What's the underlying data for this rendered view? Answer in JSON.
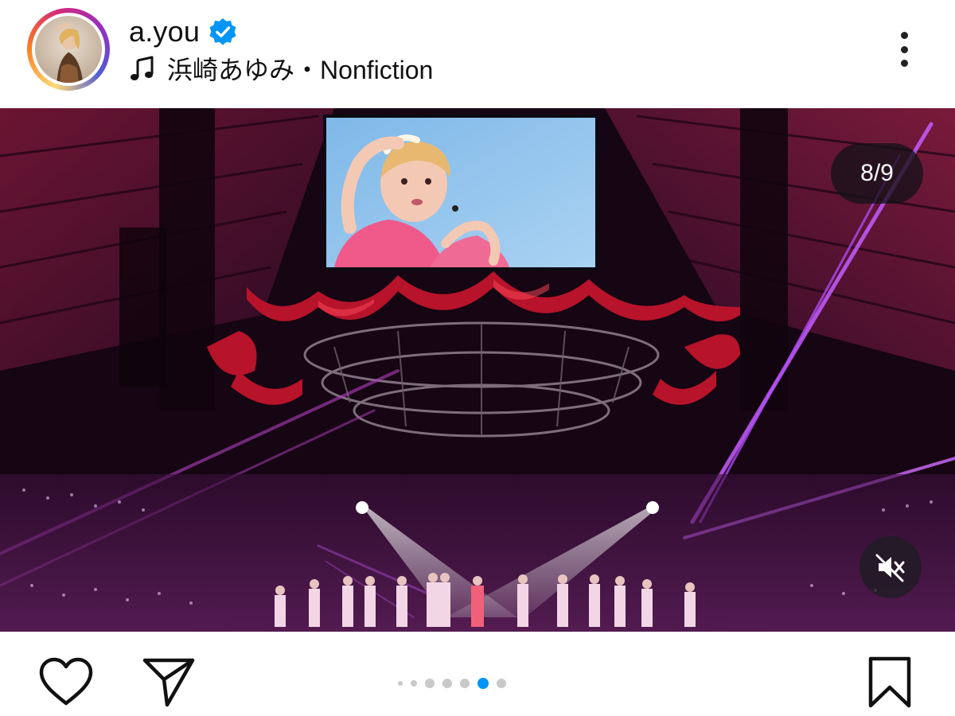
{
  "post": {
    "username": "a.you",
    "verified": true,
    "audio": {
      "artist": "浜崎あゆみ",
      "separator": "・",
      "track": "Nonfiction"
    }
  },
  "carousel": {
    "counter": "8/9",
    "current": 8,
    "total": 9,
    "indicator_dots": 7,
    "active_dot": 5,
    "muted": true
  },
  "icons": {
    "verified": "verified-badge-icon",
    "audio": "music-note-icon",
    "menu": "more-vertical-icon",
    "mute": "speaker-muted-icon",
    "like": "heart-icon",
    "share": "send-icon",
    "save": "bookmark-icon"
  },
  "colors": {
    "verified_blue": "#0095f6",
    "active_dot": "#0095f6",
    "inactive_dot": "#c9c9c9",
    "icon_dark": "#111111"
  }
}
